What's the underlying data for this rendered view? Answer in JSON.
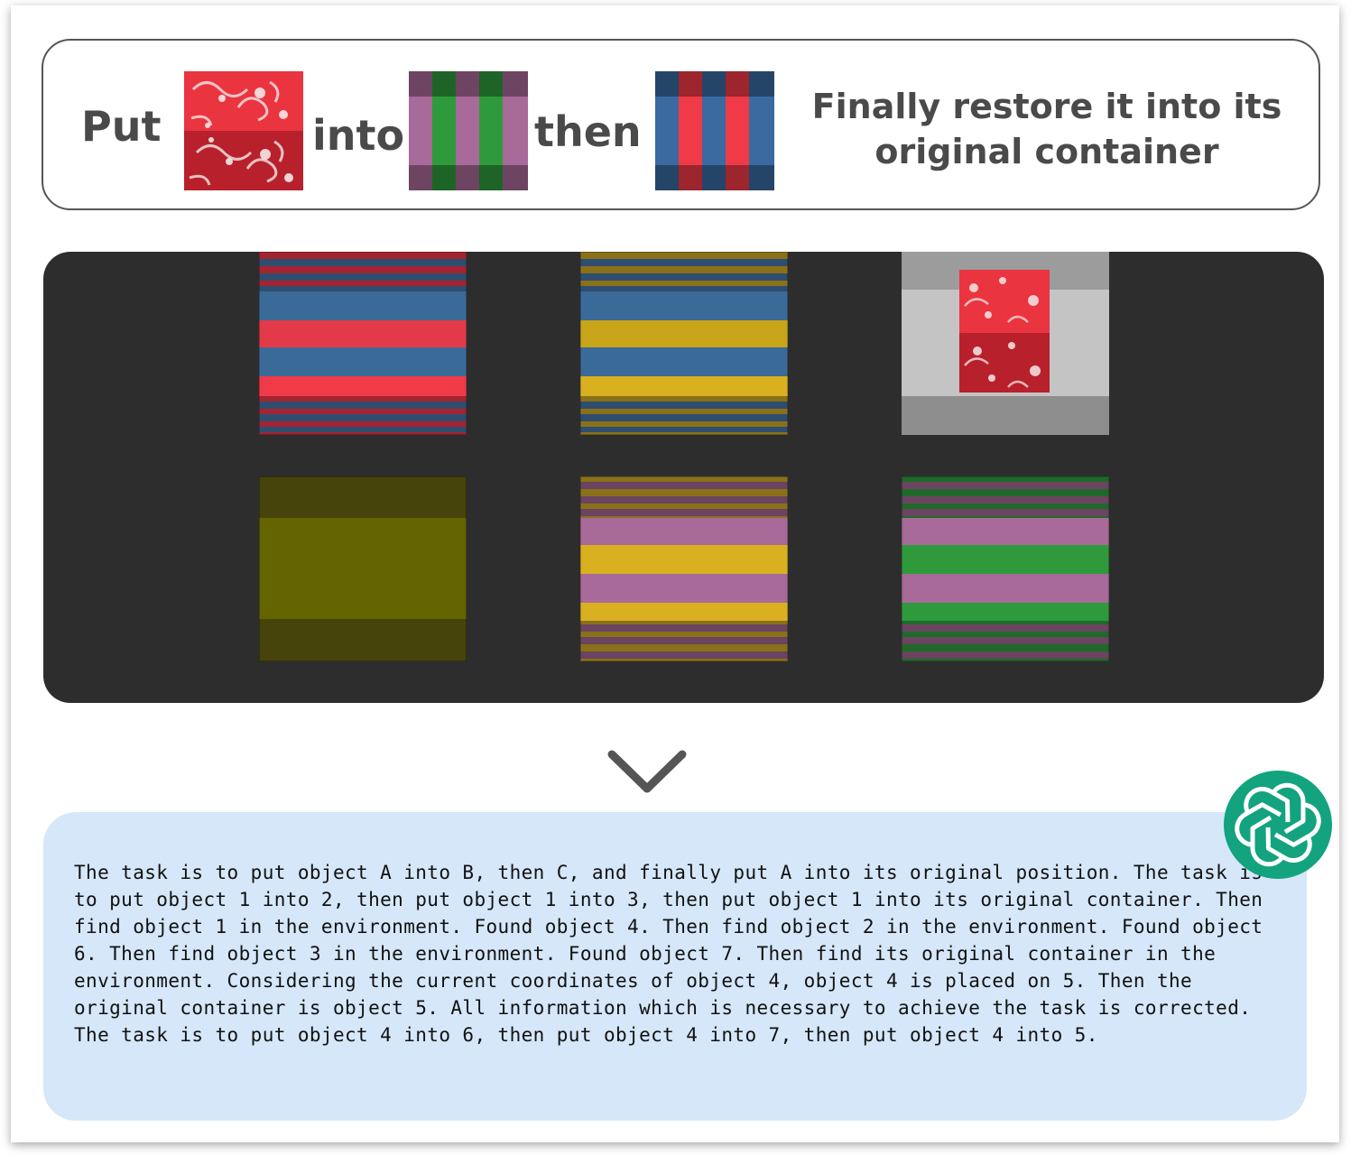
{
  "instruction": {
    "word_put": "Put",
    "word_into": "into",
    "word_then": "then",
    "final_text": "Finally restore it into its original container",
    "swatches": [
      {
        "name": "object-a-red-paisley",
        "colors": [
          "#e8303c",
          "#b8202a",
          "#ffffff"
        ]
      },
      {
        "name": "object-b-purple-green-stripes",
        "colors": [
          "#a86a98",
          "#2f9a3c",
          "#6e4460",
          "#1f6a2a"
        ]
      },
      {
        "name": "object-c-blue-red-stripes",
        "colors": [
          "#3a6aa0",
          "#f03a48",
          "#2a4a6e",
          "#9a2030"
        ]
      }
    ]
  },
  "scene": {
    "background": "#2d2d2d",
    "objects": [
      {
        "id": "red-blue-striped-box",
        "colors": [
          "#e83a48",
          "#3a6a98"
        ]
      },
      {
        "id": "yellow-blue-striped-box",
        "colors": [
          "#d8b020",
          "#3a6a98"
        ]
      },
      {
        "id": "white-container-with-paisley-block",
        "colors": [
          "#bdbdbd",
          "#e8303c"
        ]
      },
      {
        "id": "olive-plain-box",
        "colors": [
          "#646400"
        ]
      },
      {
        "id": "yellow-purple-striped-box",
        "colors": [
          "#d8b020",
          "#a86a98"
        ]
      },
      {
        "id": "purple-green-striped-box",
        "colors": [
          "#a86a98",
          "#2f9a3c"
        ]
      }
    ]
  },
  "arrow_icon": "chevron-down-icon",
  "response": {
    "text": "The task is to put object A into B, then C, and finally put A into its original position. The task is to put object 1 into 2, then put object 1 into 3, then put object 1 into its original container. Then find object 1 in the environment. Found object 4. Then find object 2 in the environment. Found object 6. Then find object 3 in the environment. Found object 7. Then find its original container in the environment. Considering the current coordinates of object 4, object 4 is placed on 5. Then the original container is object 5. All information which is necessary to achieve the task is corrected. The task is to put object 4 into 6, then put object 4 into 7, then put object 4 into 5.",
    "background": "#d5e7f9"
  },
  "badge": {
    "icon": "openai-logo-icon",
    "color": "#13a37f"
  }
}
